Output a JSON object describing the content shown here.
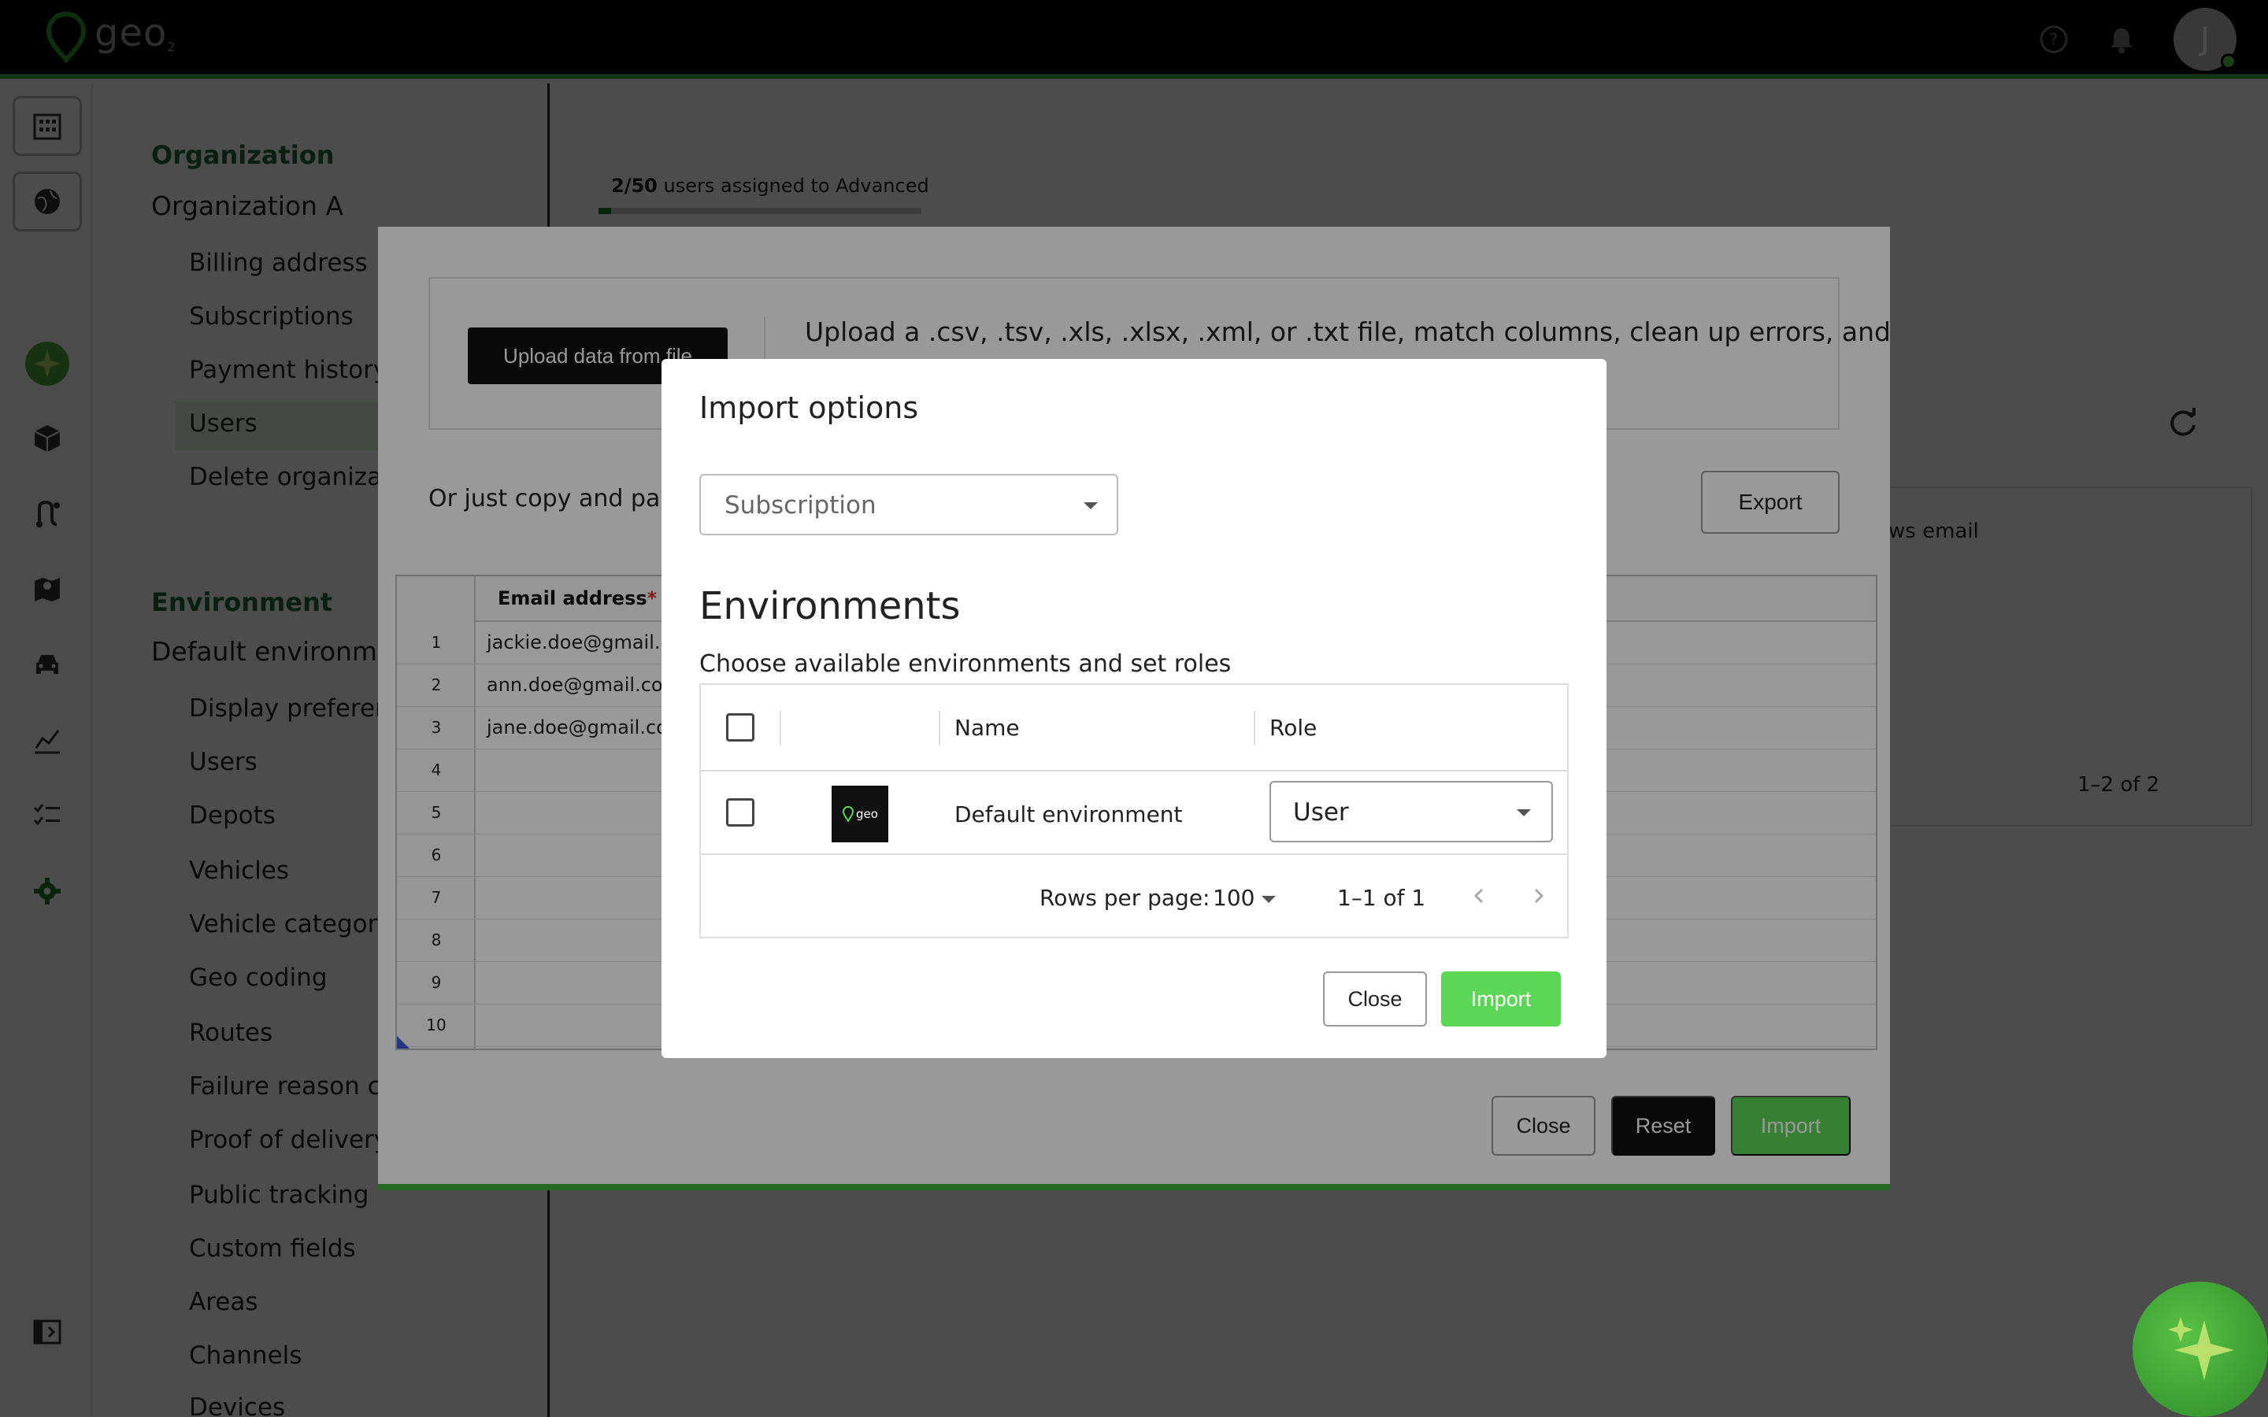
{
  "app": {
    "logo_text": "geo",
    "logo_sub": "2"
  },
  "topbar": {
    "avatar_initial": "J"
  },
  "sidebar_nav": {
    "org_section": "Organization",
    "org_name": "Organization A",
    "org_items": [
      "Billing address",
      "Subscriptions",
      "Payment history",
      "Users",
      "Delete organization"
    ],
    "env_section": "Environment",
    "env_name": "Default environment",
    "env_items": [
      "Display preferences",
      "Users",
      "Depots",
      "Vehicles",
      "Vehicle categories",
      "Geo coding",
      "Routes",
      "Failure reason codes",
      "Proof of delivery",
      "Public tracking",
      "Custom fields",
      "Areas",
      "Channels",
      "Devices"
    ]
  },
  "main": {
    "assigned_count": "2/50",
    "assigned_text": " users assigned to Advanced",
    "assigned_fraction": 0.04,
    "bg_col_header": "ws email",
    "bg_range": "1–2 of 2"
  },
  "import_dialog": {
    "upload_button": "Upload data from file",
    "upload_desc": "Upload a .csv, .tsv, .xls, .xlsx, .xml, or .txt file, match columns, clean up errors, and",
    "paste_text": "Or just copy and paste",
    "export_button": "Export",
    "email_header": "Email address",
    "required_mark": "*",
    "rows": [
      {
        "num": "1",
        "email": "jackie.doe@gmail.co"
      },
      {
        "num": "2",
        "email": "ann.doe@gmail.com"
      },
      {
        "num": "3",
        "email": "jane.doe@gmail.com"
      },
      {
        "num": "4",
        "email": ""
      },
      {
        "num": "5",
        "email": ""
      },
      {
        "num": "6",
        "email": ""
      },
      {
        "num": "7",
        "email": ""
      },
      {
        "num": "8",
        "email": ""
      },
      {
        "num": "9",
        "email": ""
      },
      {
        "num": "10",
        "email": ""
      }
    ],
    "close_button": "Close",
    "reset_button": "Reset",
    "import_button": "Import"
  },
  "modal": {
    "title": "Import options",
    "subscription_placeholder": "Subscription",
    "env_title": "Environments",
    "env_subtitle": "Choose available environments and set roles",
    "col_name": "Name",
    "col_role": "Role",
    "env_row": {
      "name": "Default environment",
      "role": "User",
      "thumb_text": "geo"
    },
    "rows_per_page_label": "Rows per page:",
    "rows_per_page_value": "100",
    "range": "1–1 of 1",
    "close_button": "Close",
    "import_button": "Import"
  },
  "colors": {
    "accent": "#3fae3a",
    "button_green": "#5cd655",
    "section_green": "#1f6b3a"
  }
}
